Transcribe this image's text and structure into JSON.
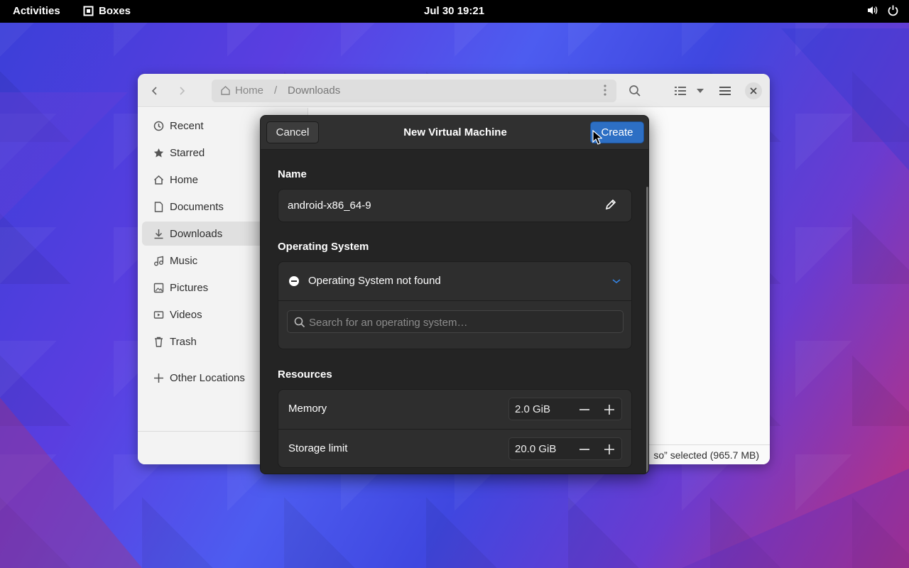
{
  "topbar": {
    "activities": "Activities",
    "app_name": "Boxes",
    "clock": "Jul 30  19:21"
  },
  "files": {
    "path": {
      "home": "Home",
      "separator": "/",
      "current": "Downloads"
    },
    "sidebar": [
      {
        "label": "Recent",
        "icon": "clock-icon"
      },
      {
        "label": "Starred",
        "icon": "star-icon"
      },
      {
        "label": "Home",
        "icon": "home-icon"
      },
      {
        "label": "Documents",
        "icon": "document-icon"
      },
      {
        "label": "Downloads",
        "icon": "download-icon"
      },
      {
        "label": "Music",
        "icon": "music-icon"
      },
      {
        "label": "Pictures",
        "icon": "picture-icon"
      },
      {
        "label": "Videos",
        "icon": "video-icon"
      },
      {
        "label": "Trash",
        "icon": "trash-icon"
      }
    ],
    "other_locations": "Other Locations",
    "status": "so” selected  (965.7 MB)"
  },
  "dialog": {
    "cancel": "Cancel",
    "title": "New Virtual Machine",
    "create": "Create",
    "name_section": "Name",
    "name_value": "android-x86_64-9",
    "os_section": "Operating System",
    "os_value": "Operating System not found",
    "os_search_placeholder": "Search for an operating system…",
    "resources_section": "Resources",
    "memory_label": "Memory",
    "memory_value": "2.0 GiB",
    "storage_label": "Storage limit",
    "storage_value": "20.0 GiB"
  },
  "colors": {
    "accent": "#2d6fc4",
    "dialog_bg": "#242424",
    "chevron": "#3584e4"
  }
}
